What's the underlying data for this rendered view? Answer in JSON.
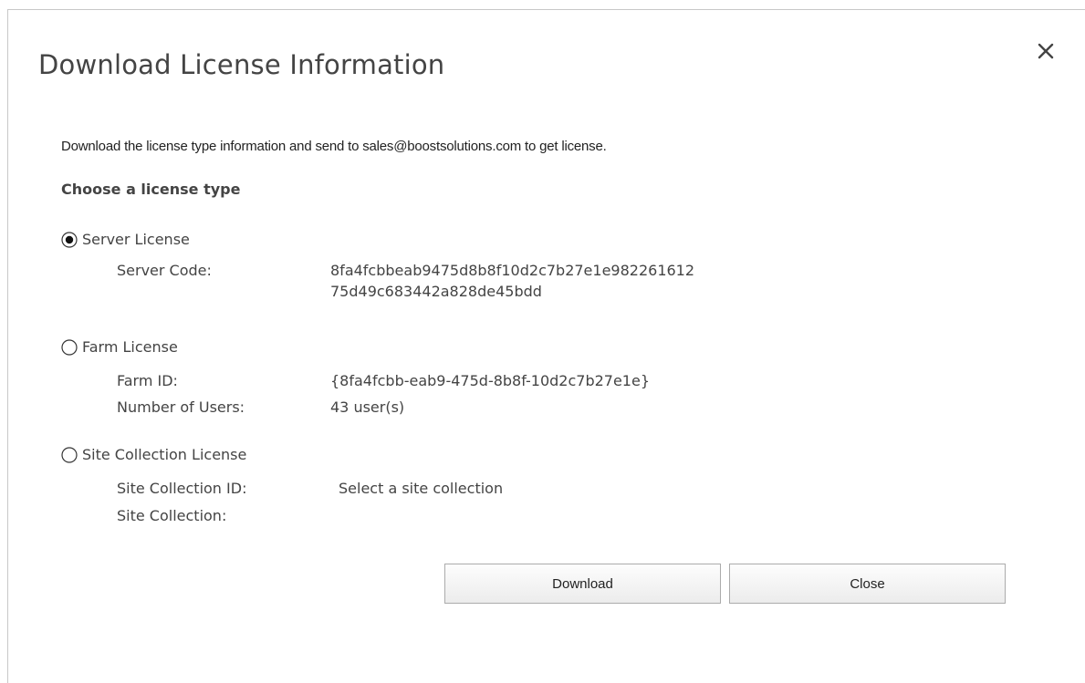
{
  "dialog": {
    "title": "Download License Information",
    "close_icon": "close-icon",
    "intro_text": "Download the license type information and send to sales@boostsolutions.com to get license.",
    "section_heading": "Choose a license type"
  },
  "options": {
    "server": {
      "label": "Server License",
      "selected": true,
      "code_label": "Server Code:",
      "code_line1": "8fa4fcbbeab9475d8b8f10d2c7b27e1e982261612",
      "code_line2": "75d49c683442a828de45bdd"
    },
    "farm": {
      "label": "Farm License",
      "selected": false,
      "id_label": "Farm ID:",
      "id_value": "{8fa4fcbb-eab9-475d-8b8f-10d2c7b27e1e}",
      "users_label": "Number of Users:",
      "users_value": "43 user(s)"
    },
    "site_collection": {
      "label": "Site Collection License",
      "selected": false,
      "id_label": "Site Collection ID:",
      "id_value": "Select a site collection",
      "collection_label": "Site Collection:"
    }
  },
  "buttons": {
    "download_label": "Download",
    "close_label": "Close"
  }
}
